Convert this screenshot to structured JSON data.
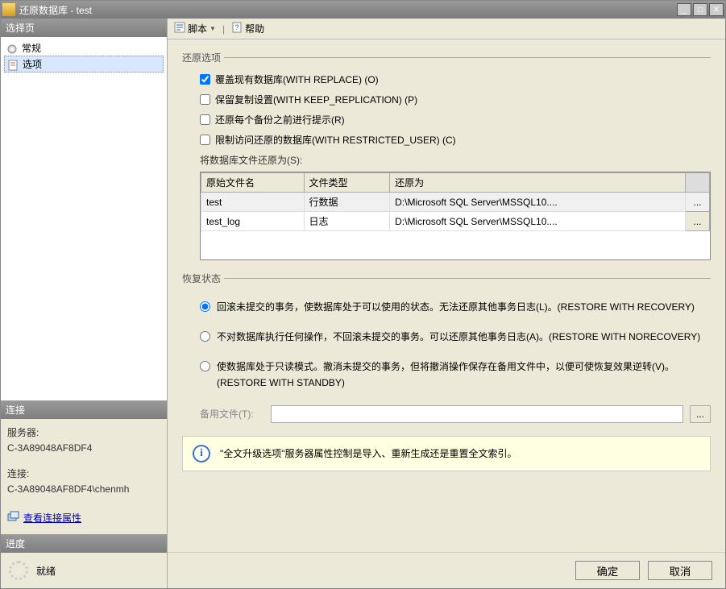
{
  "window": {
    "title": "还原数据库 - test"
  },
  "sidebar": {
    "select_header": "选择页",
    "items": [
      {
        "label": "常规"
      },
      {
        "label": "选项"
      }
    ],
    "conn_header": "连接",
    "server_label": "服务器:",
    "server_value": "C-3A89048AF8DF4",
    "conn_label": "连接:",
    "conn_value": "C-3A89048AF8DF4\\chenmh",
    "view_link": "查看连接属性",
    "progress_header": "进度",
    "progress_status": "就绪"
  },
  "toolbar": {
    "script": "脚本",
    "help": "帮助"
  },
  "restore_options": {
    "title": "还原选项",
    "overwrite": "覆盖现有数据库(WITH REPLACE) (O)",
    "keep_replication": "保留复制设置(WITH KEEP_REPLICATION) (P)",
    "prompt_each": "还原每个备份之前进行提示(R)",
    "restricted_user": "限制访问还原的数据库(WITH RESTRICTED_USER) (C)",
    "files_label": "将数据库文件还原为(S):"
  },
  "table": {
    "headers": {
      "orig": "原始文件名",
      "type": "文件类型",
      "restore_as": "还原为"
    },
    "rows": [
      {
        "name": "test",
        "type": "行数据",
        "path": "D:\\Microsoft SQL Server\\MSSQL10...."
      },
      {
        "name": "test_log",
        "type": "日志",
        "path": "D:\\Microsoft SQL Server\\MSSQL10...."
      }
    ],
    "ellipsis": "..."
  },
  "recovery": {
    "title": "恢复状态",
    "opt1": "回滚未提交的事务，使数据库处于可以使用的状态。无法还原其他事务日志(L)。(RESTORE WITH RECOVERY)",
    "opt2": "不对数据库执行任何操作，不回滚未提交的事务。可以还原其他事务日志(A)。(RESTORE WITH NORECOVERY)",
    "opt3": "使数据库处于只读模式。撤消未提交的事务，但将撤消操作保存在备用文件中，以便可使恢复效果逆转(V)。(RESTORE WITH STANDBY)",
    "standby_label": "备用文件(T):"
  },
  "info": {
    "text": "\"全文升级选项\"服务器属性控制是导入、重新生成还是重置全文索引。"
  },
  "buttons": {
    "ok": "确定",
    "cancel": "取消"
  }
}
